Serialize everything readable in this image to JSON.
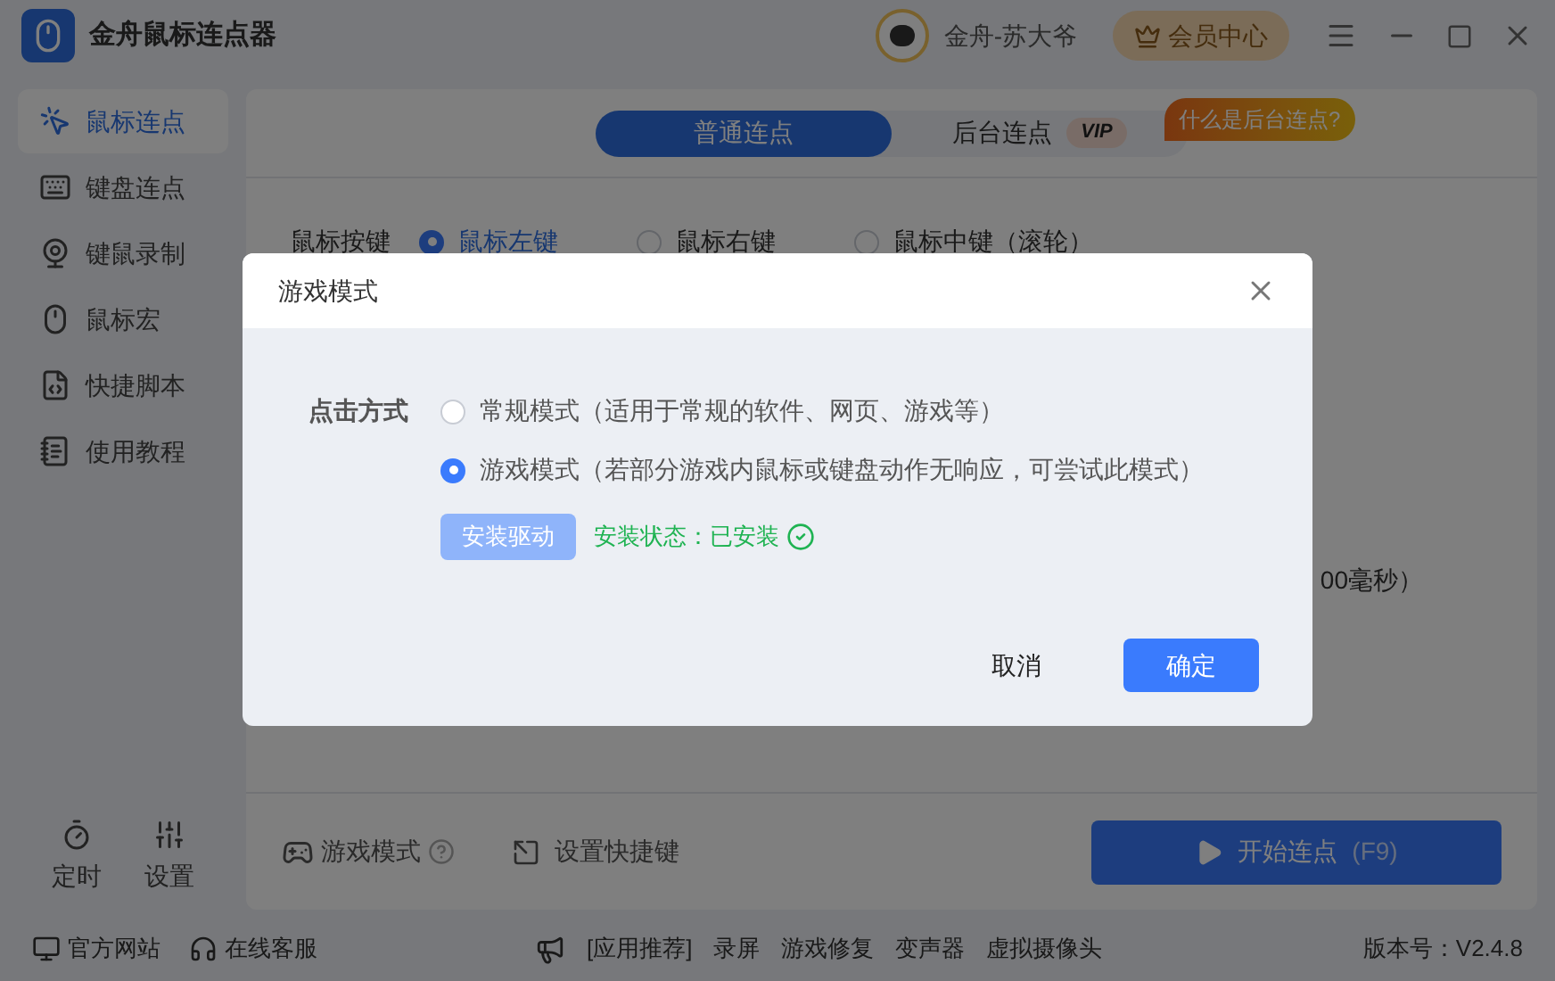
{
  "app": {
    "title": "金舟鼠标连点器",
    "user_name": "金舟-苏大爷",
    "member_button": "会员中心"
  },
  "sidebar": {
    "items": [
      {
        "label": "鼠标连点",
        "selected": true
      },
      {
        "label": "键盘连点",
        "selected": false
      },
      {
        "label": "键鼠录制",
        "selected": false
      },
      {
        "label": "鼠标宏",
        "selected": false
      },
      {
        "label": "快捷脚本",
        "selected": false
      },
      {
        "label": "使用教程",
        "selected": false
      }
    ],
    "tools": [
      {
        "label": "定时"
      },
      {
        "label": "设置"
      }
    ]
  },
  "tabs": [
    {
      "label": "普通连点",
      "selected": true
    },
    {
      "label": "后台连点",
      "selected": false,
      "badge": "VIP"
    }
  ],
  "tip": "什么是后台连点?",
  "mouse_button": {
    "label": "鼠标按键",
    "options": [
      {
        "label": "鼠标左键",
        "selected": true
      },
      {
        "label": "鼠标右键",
        "selected": false
      },
      {
        "label": "鼠标中键（滚轮）",
        "selected": false
      }
    ]
  },
  "interval_tail": "00毫秒）",
  "bottom_bar": {
    "game_mode": "游戏模式",
    "hotkey": "设置快捷键",
    "start_button": "开始连点",
    "start_key": "(F9)"
  },
  "footer": {
    "links": [
      "官方网站",
      "在线客服"
    ],
    "promo_label": "[应用推荐]",
    "promo_items": [
      "录屏",
      "游戏修复",
      "变声器",
      "虚拟摄像头"
    ],
    "version": "版本号：V2.4.8"
  },
  "dialog": {
    "title": "游戏模式",
    "field_label": "点击方式",
    "options": [
      {
        "label": "常规模式（适用于常规的软件、网页、游戏等）",
        "selected": false
      },
      {
        "label": "游戏模式（若部分游戏内鼠标或键盘动作无响应，可尝试此模式）",
        "selected": true
      }
    ],
    "install_button": {
      "label": "安装驱动",
      "disabled": true
    },
    "status": "安装状态：已安装",
    "buttons": [
      "取消",
      "确定"
    ]
  }
}
